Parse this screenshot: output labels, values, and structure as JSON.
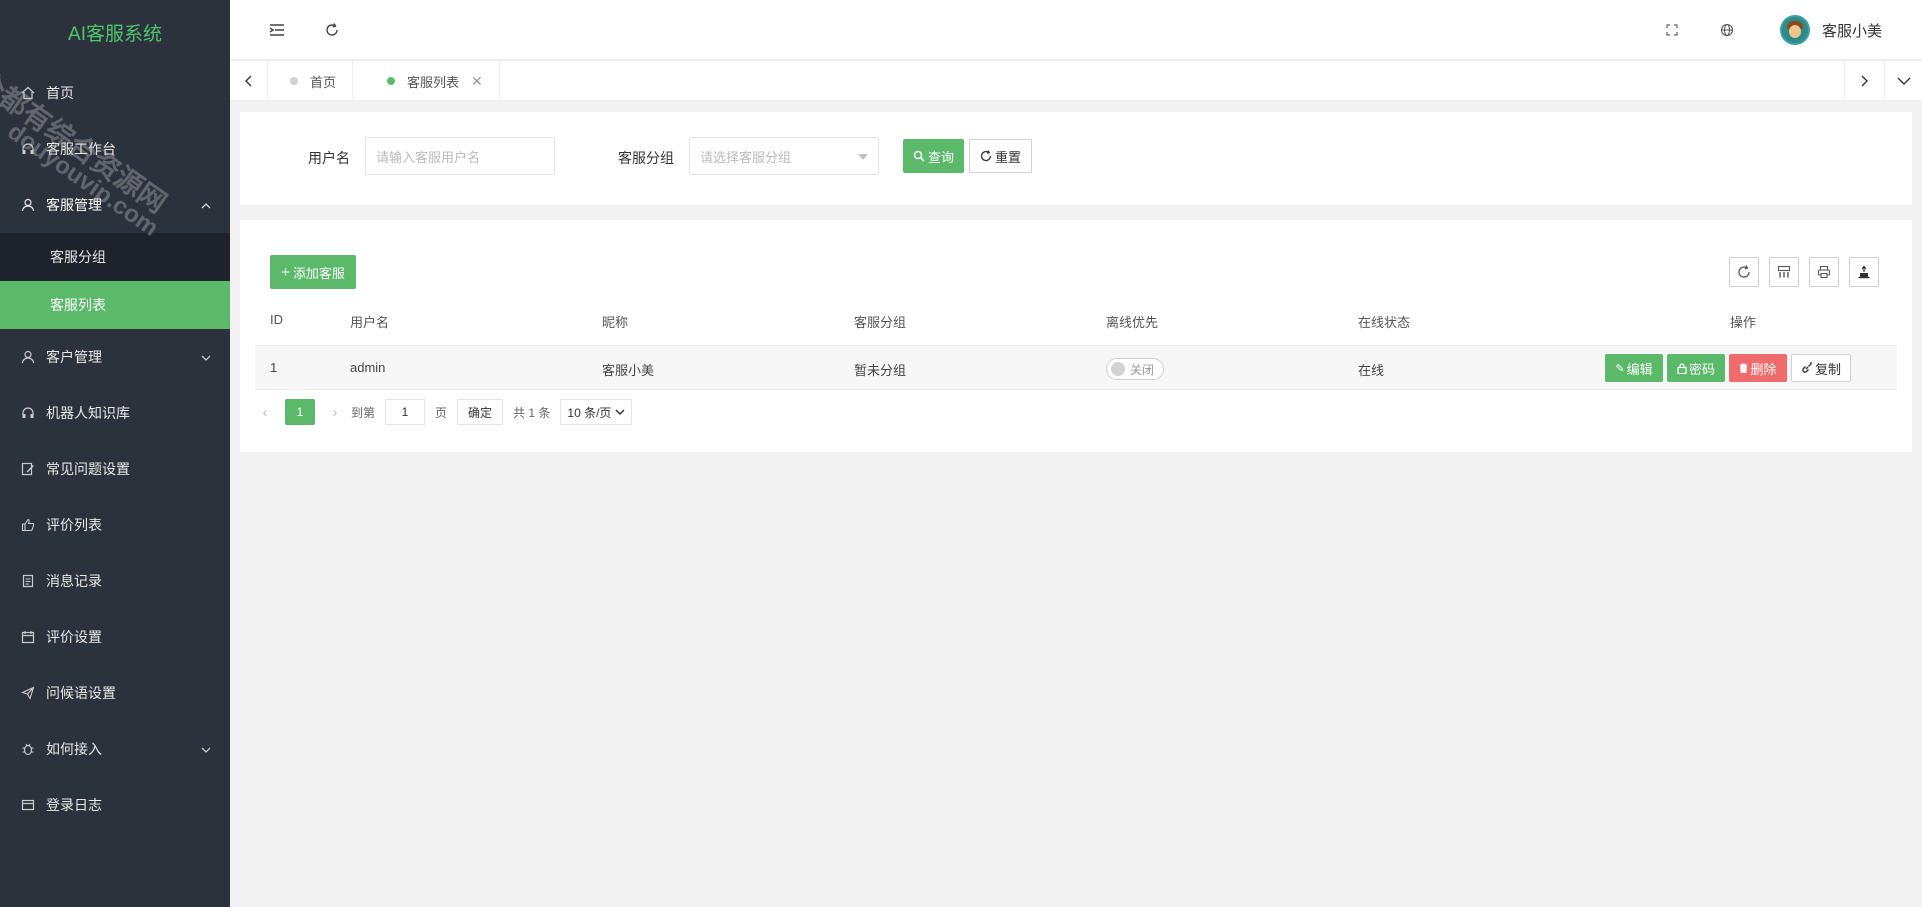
{
  "app": {
    "title": "AI客服系统"
  },
  "watermark": {
    "line1": "全都有综合资源网",
    "line2": "douyouvip.com"
  },
  "sidebar": {
    "items": [
      {
        "label": "首页",
        "icon": "home-icon"
      },
      {
        "label": "客服工作台",
        "icon": "headset-icon"
      },
      {
        "label": "客服管理",
        "icon": "user-icon",
        "expanded": true,
        "children": [
          {
            "label": "客服分组"
          },
          {
            "label": "客服列表",
            "active": true
          }
        ]
      },
      {
        "label": "客户管理",
        "icon": "user-icon",
        "expandable": true
      },
      {
        "label": "机器人知识库",
        "icon": "headset-icon"
      },
      {
        "label": "常见问题设置",
        "icon": "edit-icon"
      },
      {
        "label": "评价列表",
        "icon": "thumbs-up-icon"
      },
      {
        "label": "消息记录",
        "icon": "document-icon"
      },
      {
        "label": "评价设置",
        "icon": "calendar-icon"
      },
      {
        "label": "问候语设置",
        "icon": "send-icon"
      },
      {
        "label": "如何接入",
        "icon": "bug-icon",
        "expandable": true
      },
      {
        "label": "登录日志",
        "icon": "credit-card-icon"
      }
    ]
  },
  "header": {
    "username": "客服小美"
  },
  "tabs": [
    {
      "label": "首页",
      "active": false
    },
    {
      "label": "客服列表",
      "active": true
    }
  ],
  "search": {
    "username_label": "用户名",
    "username_placeholder": "请输入客服用户名",
    "group_label": "客服分组",
    "group_placeholder": "请选择客服分组",
    "query_label": "查询",
    "reset_label": "重置"
  },
  "toolbar": {
    "add_label": "添加客服"
  },
  "table": {
    "columns": [
      "ID",
      "用户名",
      "昵称",
      "客服分组",
      "离线优先",
      "在线状态",
      "操作"
    ],
    "rows": [
      {
        "id": "1",
        "username": "admin",
        "nickname": "客服小美",
        "group": "暂未分组",
        "offline_first": "关闭",
        "status": "在线"
      }
    ],
    "actions": {
      "edit": "编辑",
      "password": "密码",
      "delete": "删除",
      "copy": "复制"
    }
  },
  "pagination": {
    "current": "1",
    "goto_label": "到第",
    "page_input": "1",
    "page_unit": "页",
    "confirm": "确定",
    "total": "共 1 条",
    "page_size": "10 条/页"
  },
  "colors": {
    "accent": "#5bb96a",
    "danger": "#f06b6b",
    "sidebar_bg": "#2b323b"
  }
}
